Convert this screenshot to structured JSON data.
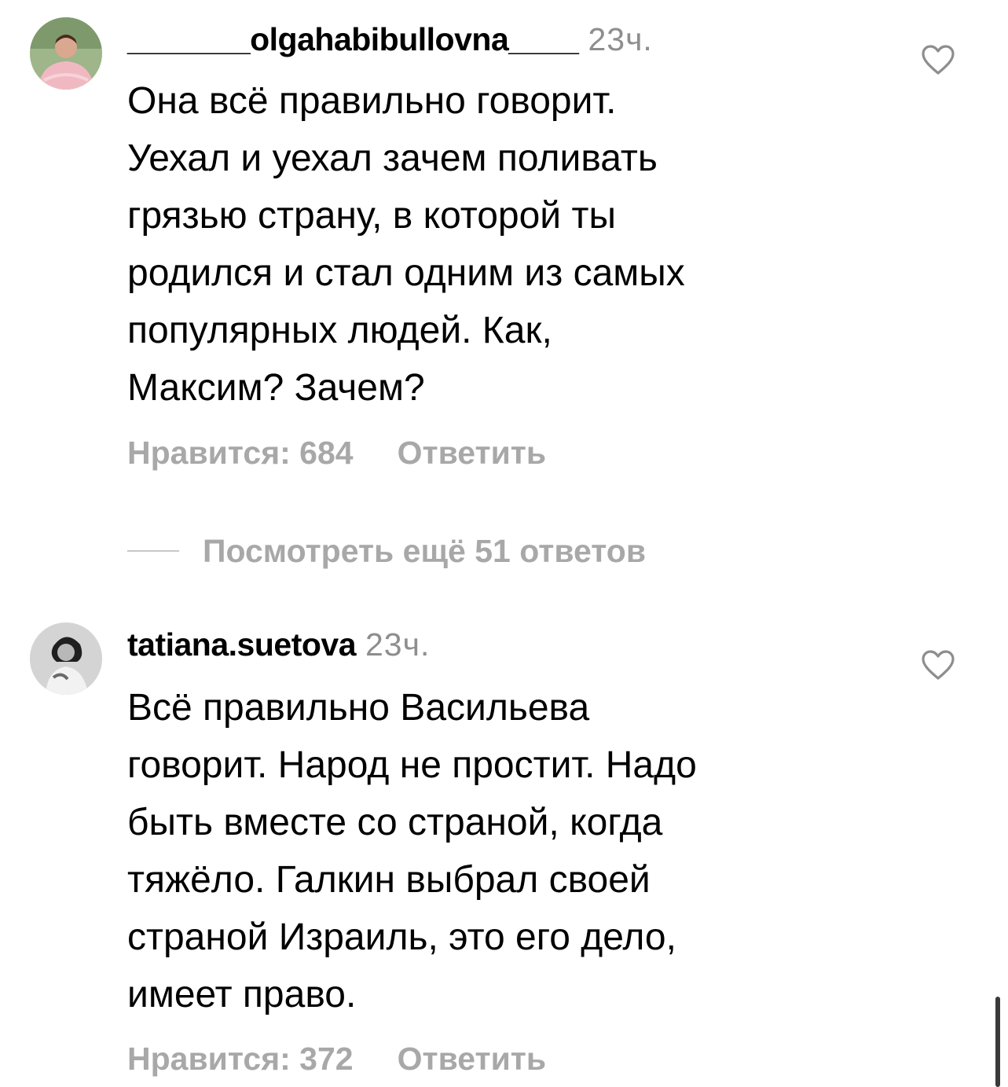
{
  "comments": [
    {
      "username": "_______olgahabibullovna____",
      "time": "23ч.",
      "text": "Она всё правильно говорит.\nУехал и уехал  зачем поливать\nгрязью страну, в которой ты\nродился и стал одним из самых\nпопулярных людей.  Как,\nМаксим? Зачем?",
      "likes": "Нравится: 684",
      "reply": "Ответить",
      "avatar_icon": "avatar-photo-woman-pink-top",
      "like_icon": "heart-outline-icon"
    },
    {
      "username": "tatiana.suetova",
      "time": "23ч.",
      "text": "Всё правильно Васильева\nговорит. Народ не простит. Надо\nбыть вместе со страной, когда\nтяжёло. Галкин выбрал своей\nстраной Израиль, это его дело,\nимеет право.",
      "likes": "Нравится: 372",
      "reply": "Ответить",
      "avatar_icon": "avatar-photo-bw-woman",
      "like_icon": "heart-outline-icon"
    }
  ],
  "view_replies": {
    "label": "Посмотреть ещё 51 ответов"
  },
  "colors": {
    "secondary_text": "#a8a8a8",
    "time_text": "#8e8e8e",
    "primary_text": "#000000"
  }
}
